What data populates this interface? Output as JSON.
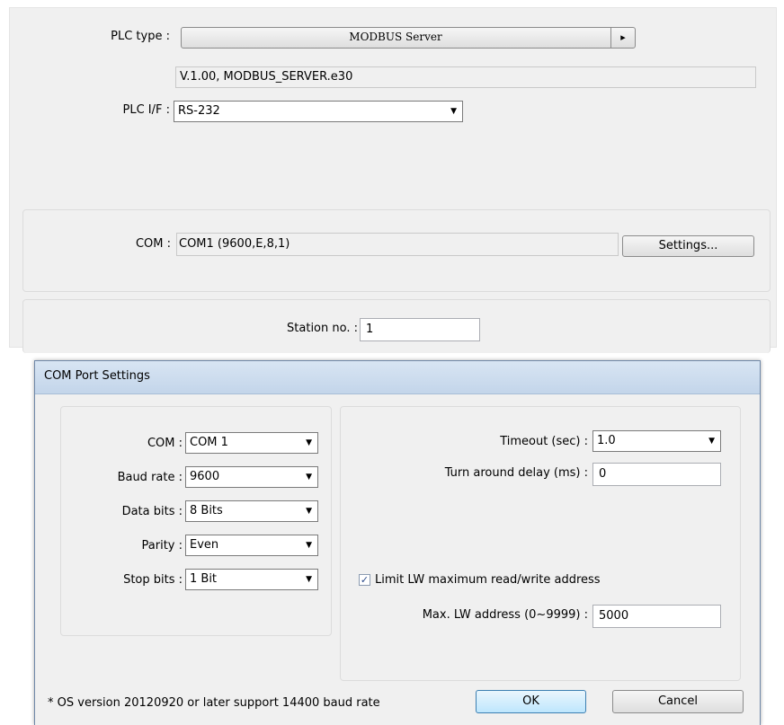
{
  "top": {
    "plc_type_label": "PLC type :",
    "plc_type_value": "MODBUS Server",
    "plc_type_arrow": "▸",
    "driver_info": "V.1.00, MODBUS_SERVER.e30",
    "plc_if_label": "PLC I/F :",
    "plc_if_value": "RS-232",
    "com_label": "COM :",
    "com_value": "COM1 (9600,E,8,1)",
    "settings_button": "Settings...",
    "station_label": "Station no. :",
    "station_value": "1"
  },
  "dialog": {
    "title": "COM Port Settings",
    "com_label": "COM :",
    "com_value": "COM 1",
    "baud_label": "Baud rate :",
    "baud_value": "9600",
    "databits_label": "Data bits :",
    "databits_value": "8 Bits",
    "parity_label": "Parity :",
    "parity_value": "Even",
    "stopbits_label": "Stop bits :",
    "stopbits_value": "1 Bit",
    "timeout_label": "Timeout (sec) :",
    "timeout_value": "1.0",
    "turnaround_label": "Turn around delay (ms) :",
    "turnaround_value": "0",
    "limit_checkbox_label": "Limit LW maximum read/write address",
    "limit_checked": true,
    "maxlw_label": "Max. LW address (0~9999) :",
    "maxlw_value": "5000",
    "footnote": "* OS version 20120920 or later support 14400 baud rate",
    "ok_button": "OK",
    "cancel_button": "Cancel"
  },
  "icons": {
    "dropdown_arrow": "▼",
    "checkmark": "✓"
  }
}
